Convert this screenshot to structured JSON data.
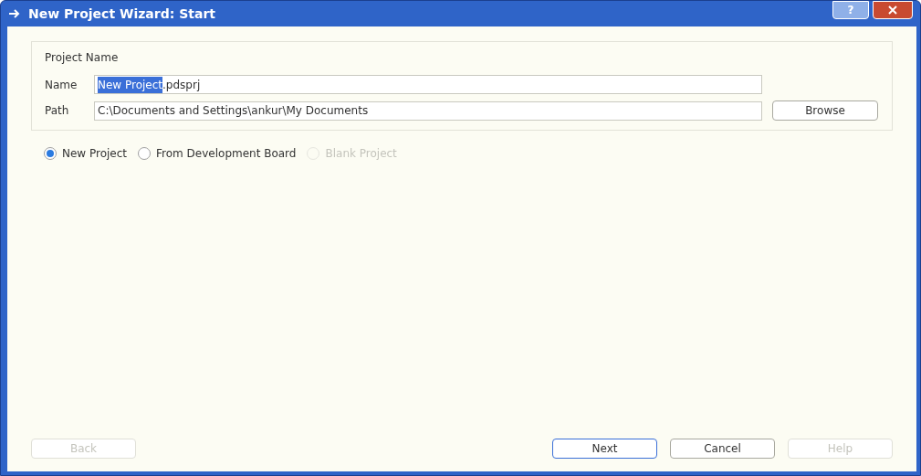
{
  "window": {
    "title": "New Project Wizard: Start",
    "help_glyph": "?"
  },
  "group": {
    "title": "Project Name",
    "fields": [
      {
        "label": "Name",
        "selected_value": "New Project",
        "value": ".pdsprj"
      },
      {
        "label": "Path",
        "value": "C:\\Documents and Settings\\ankur\\My Documents",
        "button": "Browse"
      }
    ]
  },
  "options": [
    {
      "label": "New Project",
      "selected": true,
      "disabled": false
    },
    {
      "label": "From Development Board",
      "selected": false,
      "disabled": false
    },
    {
      "label": "Blank Project",
      "selected": false,
      "disabled": true
    }
  ],
  "buttons": [
    {
      "label": "Back",
      "disabled": true,
      "default": false
    },
    {
      "label": "Next",
      "disabled": false,
      "default": true
    },
    {
      "label": "Cancel",
      "disabled": false,
      "default": false
    },
    {
      "label": "Help",
      "disabled": true,
      "default": false
    }
  ]
}
